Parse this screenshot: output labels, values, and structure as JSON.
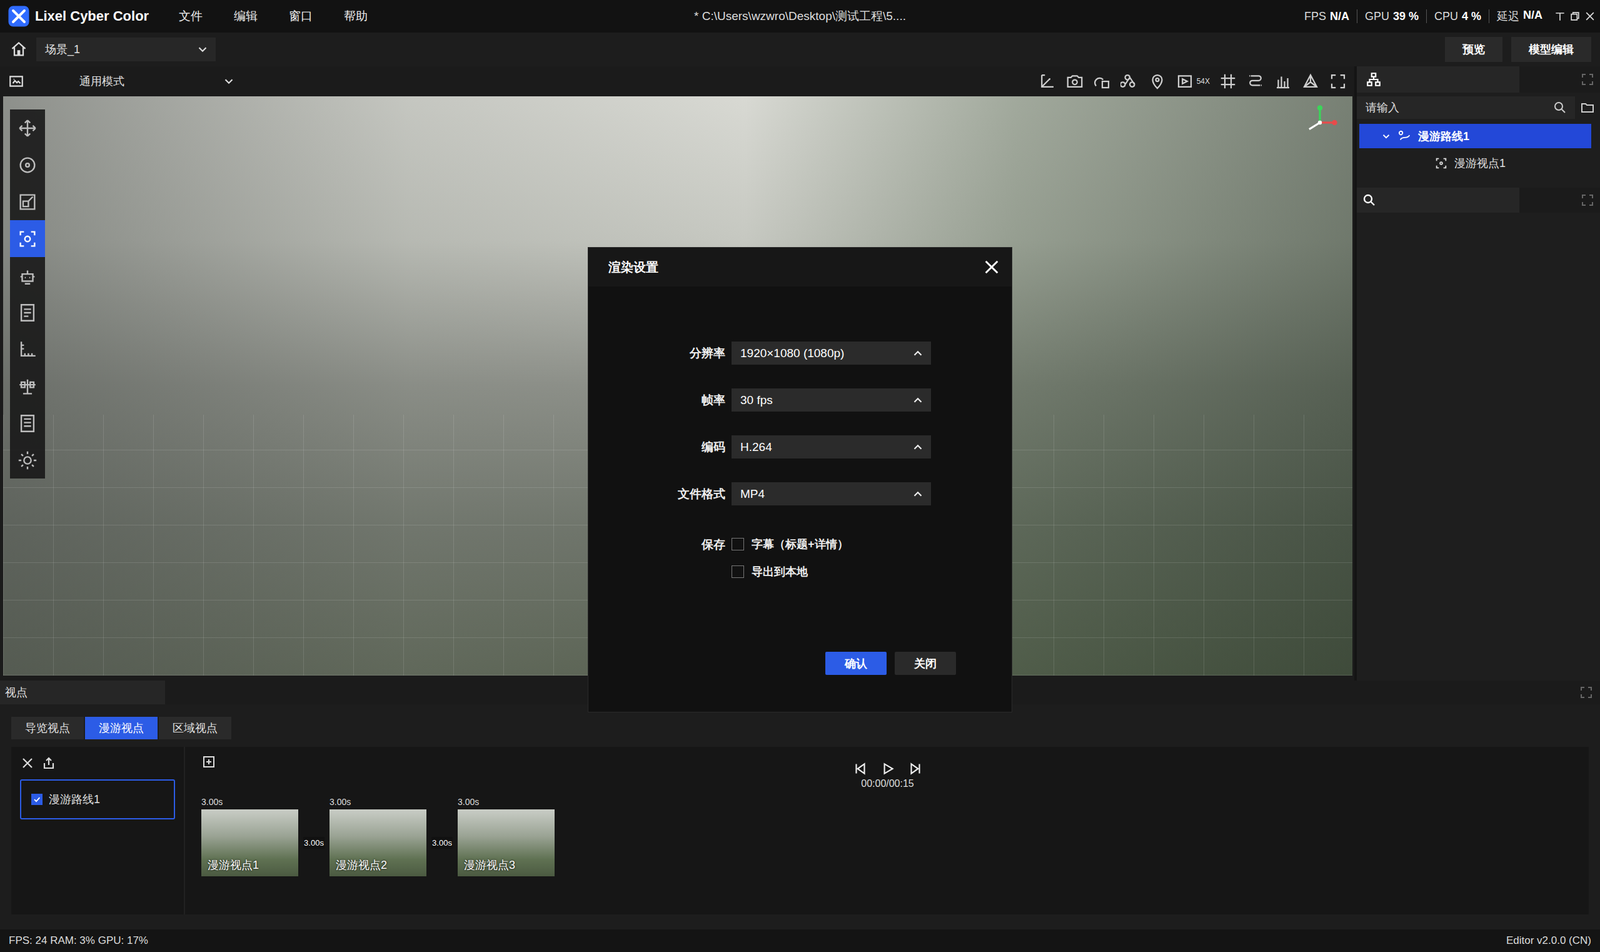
{
  "app": {
    "name": "Lixel Cyber Color"
  },
  "menu": [
    "文件",
    "编辑",
    "窗口",
    "帮助"
  ],
  "window": {
    "title": "* C:\\Users\\wzwro\\Desktop\\测试工程\\5...."
  },
  "stats": [
    {
      "label": "FPS",
      "value": "N/A"
    },
    {
      "label": "GPU",
      "value": "39 %"
    },
    {
      "label": "CPU",
      "value": "4 %"
    },
    {
      "label": "延迟",
      "value": "N/A"
    }
  ],
  "scene": {
    "value": "场景_1"
  },
  "header_buttons": [
    "预览",
    "模型编辑"
  ],
  "mode": {
    "value": "通用模式"
  },
  "toolbar": {
    "speed_badge": "54X"
  },
  "left_tools": [
    {
      "selected": false
    },
    {
      "selected": false
    },
    {
      "selected": false
    },
    {
      "selected": true
    },
    {
      "selected": false
    },
    {
      "selected": false
    },
    {
      "selected": false
    },
    {
      "selected": false
    },
    {
      "selected": false
    },
    {
      "selected": false
    }
  ],
  "outline": {
    "search_placeholder": "请输入",
    "items": [
      {
        "label": "漫游路线1",
        "level": 0,
        "expanded": true,
        "selected": true
      },
      {
        "label": "漫游视点1",
        "level": 1,
        "expanded": false,
        "selected": false
      }
    ]
  },
  "viewpoints": {
    "title": "视点",
    "tabs": [
      {
        "label": "导览视点",
        "selected": false
      },
      {
        "label": "漫游视点",
        "selected": true
      },
      {
        "label": "区域视点",
        "selected": false
      }
    ],
    "routes": [
      {
        "label": "漫游路线1",
        "checked": true,
        "selected": true
      }
    ],
    "time": "00:00/00:15",
    "points": [
      {
        "label": "漫游视点1",
        "duration": "3.00s"
      },
      {
        "label": "漫游视点2",
        "duration": "3.00s"
      },
      {
        "label": "漫游视点3",
        "duration": "3.00s"
      }
    ],
    "transitions": [
      "3.00s",
      "3.00s"
    ]
  },
  "dialog": {
    "title": "渲染设置",
    "fields": [
      {
        "label": "分辨率",
        "value": "1920×1080 (1080p)"
      },
      {
        "label": "帧率",
        "value": "30 fps"
      },
      {
        "label": "编码",
        "value": "H.264"
      },
      {
        "label": "文件格式",
        "value": "MP4"
      }
    ],
    "save_label": "保存",
    "options": [
      {
        "label": "字幕（标题+详情）",
        "checked": false
      },
      {
        "label": "导出到本地",
        "checked": false
      }
    ],
    "buttons": [
      {
        "label": "确认",
        "primary": true
      },
      {
        "label": "关闭",
        "primary": false
      }
    ]
  },
  "status_bar": {
    "left": "FPS: 24 RAM: 3% GPU: 17%",
    "right": "Editor v2.0.0 (CN)"
  }
}
